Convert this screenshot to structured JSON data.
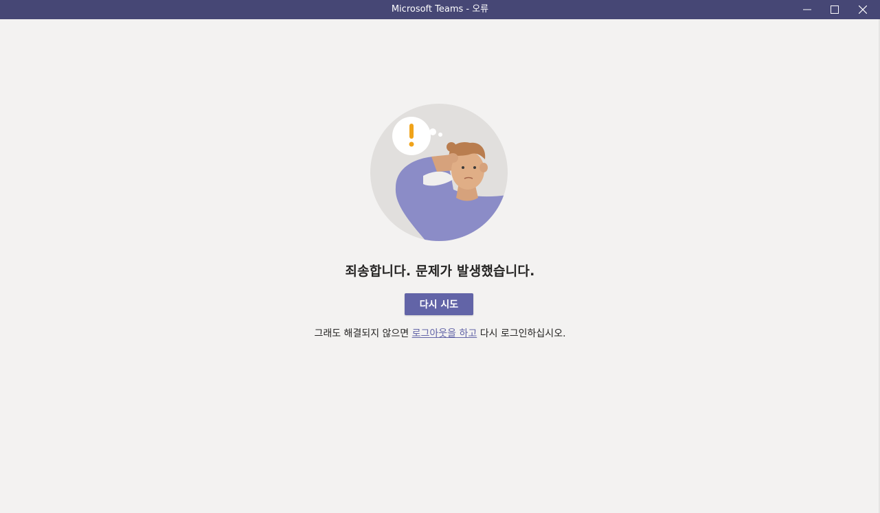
{
  "window": {
    "title": "Microsoft Teams - 오류"
  },
  "titlebar_controls": {
    "minimize_icon": "minimize-icon",
    "maximize_icon": "maximize-icon",
    "close_icon": "close-icon"
  },
  "error": {
    "heading": "죄송합니다. 문제가 발생했습니다.",
    "retry_label": "다시 시도",
    "hint_prefix": "그래도 해결되지 않으면 ",
    "hint_link": "로그아웃을 하고",
    "hint_suffix": " 다시 로그인하십시오."
  },
  "colors": {
    "titlebar": "#464775",
    "background": "#f3f2f1",
    "accent": "#6264a7",
    "text": "#252423"
  }
}
